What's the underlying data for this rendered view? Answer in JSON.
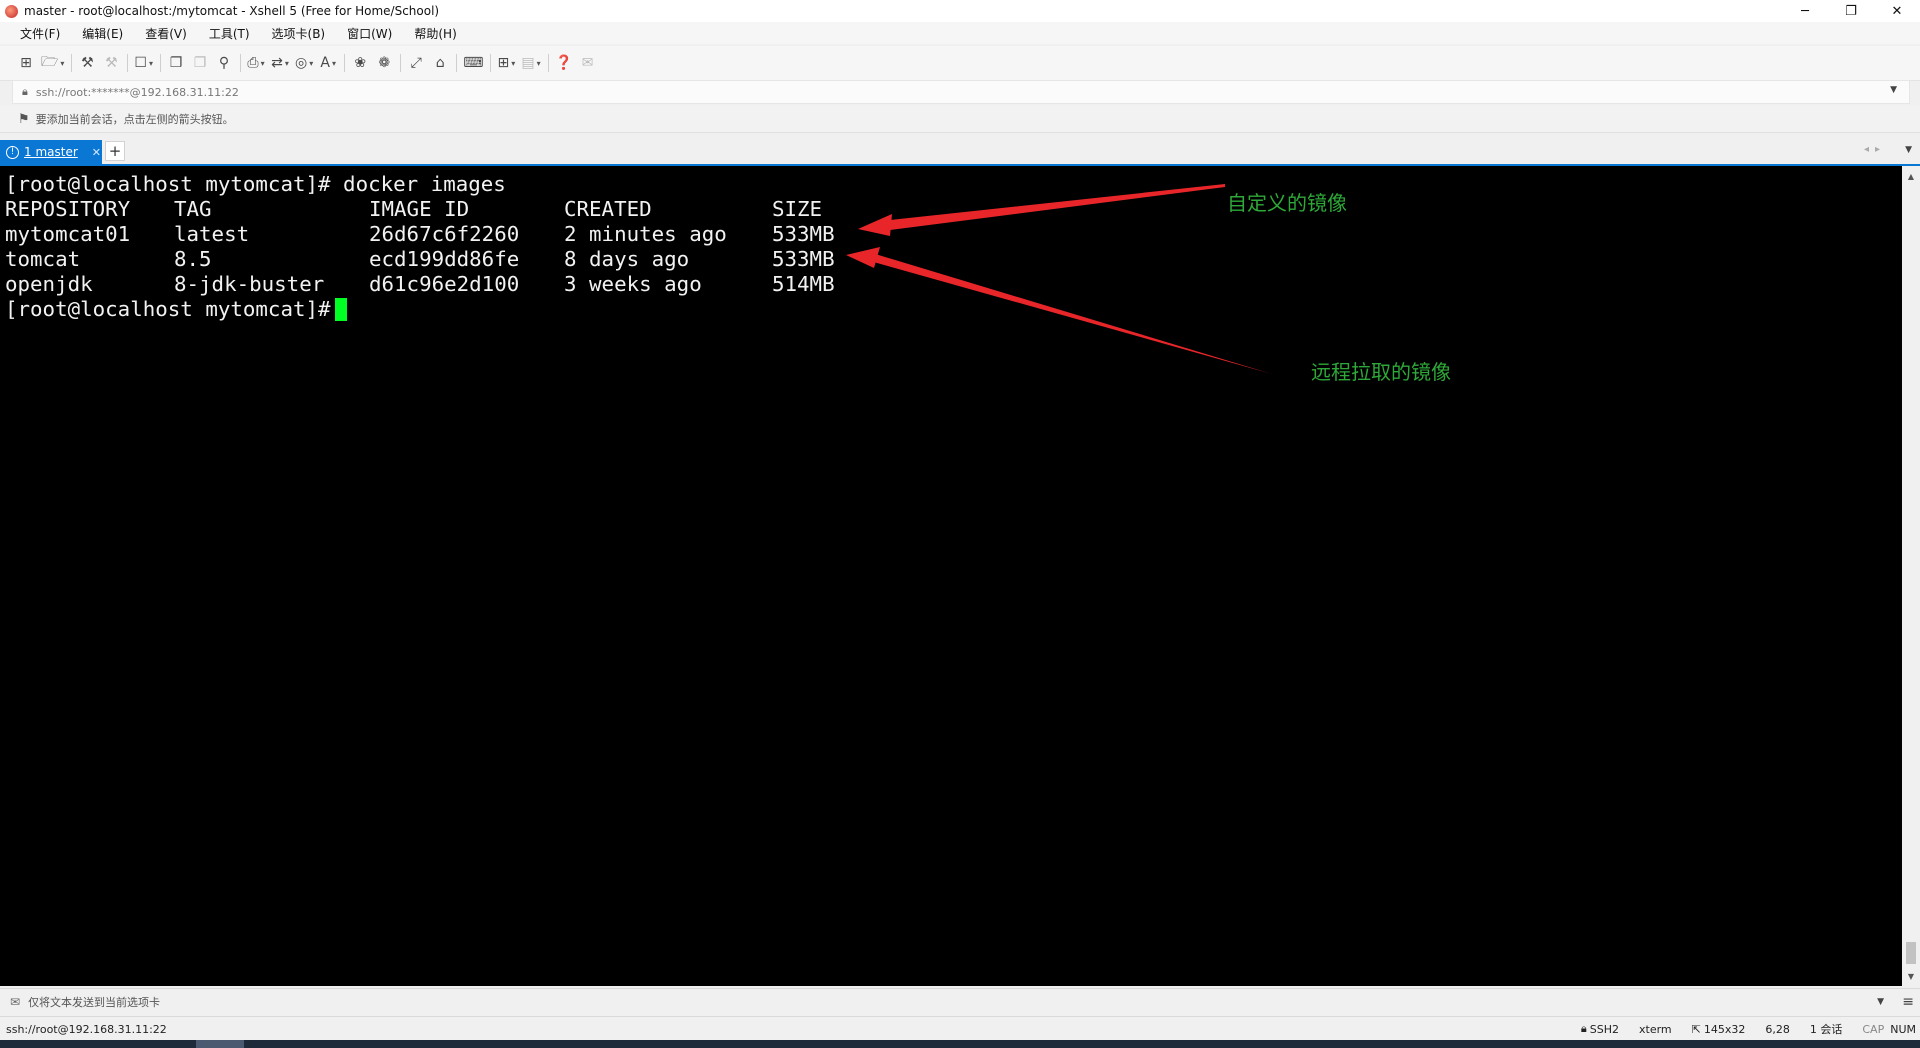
{
  "window": {
    "title": "master - root@localhost:/mytomcat - Xshell 5 (Free for Home/School)",
    "controls": {
      "minimize": "─",
      "restore": "❐",
      "close": "✕"
    }
  },
  "menu": [
    "文件(F)",
    "编辑(E)",
    "查看(V)",
    "工具(T)",
    "选项卡(B)",
    "窗口(W)",
    "帮助(H)"
  ],
  "toolbar": {
    "icons": [
      "new-session-icon",
      "open-folder-icon",
      "reconnect-icon",
      "disconnect-icon",
      "properties-icon",
      "copy-icon",
      "paste-icon",
      "find-icon",
      "print-icon",
      "transfer-icon",
      "globe-icon",
      "font-icon",
      "xftp-icon",
      "xmanager-icon",
      "fullscreen-icon",
      "lock-icon",
      "keyboard-icon",
      "add-tab-icon",
      "layout-icon",
      "help-icon",
      "chat-icon"
    ]
  },
  "address": {
    "value": "ssh://root:*******@192.168.31.11:22"
  },
  "hint": {
    "text": "要添加当前会话，点击左侧的箭头按钮。"
  },
  "tabs": [
    {
      "number": "1",
      "label": "1 master",
      "active": true
    }
  ],
  "terminal": {
    "background": "#000000",
    "foreground": "#f2f2f2",
    "cursor_color": "#00ff22",
    "prompt_line": "[root@localhost mytomcat]# docker images",
    "headers": [
      "REPOSITORY",
      "TAG",
      "IMAGE ID",
      "CREATED",
      "SIZE"
    ],
    "rows": [
      [
        "mytomcat01",
        "latest",
        "26d67c6f2260",
        "2 minutes ago",
        "533MB"
      ],
      [
        "tomcat",
        "8.5",
        "ecd199dd86fe",
        "8 days ago",
        "533MB"
      ],
      [
        "openjdk",
        "8-jdk-buster",
        "d61c96e2d100",
        "3 weeks ago",
        "514MB"
      ]
    ],
    "final_prompt": "[root@localhost mytomcat]#"
  },
  "annotations": {
    "custom_image": "自定义的镜像",
    "remote_image": "远程拉取的镜像",
    "arrow_color": "#e8262a",
    "text_color": "#2ea838"
  },
  "sendbar": {
    "text": "仅将文本发送到当前选项卡"
  },
  "status": {
    "connection": "ssh://root@192.168.31.11:22",
    "protocol": "SSH2",
    "terminal_type": "xterm",
    "size": "145x32",
    "cursor_pos": "6,28",
    "sessions": "1 会话",
    "cap": "CAP",
    "num": "NUM"
  }
}
